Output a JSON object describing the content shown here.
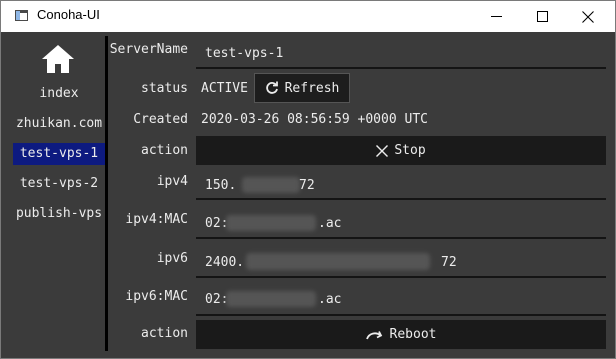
{
  "window": {
    "title": "Conoha-UI"
  },
  "sidebar": {
    "home_icon": "home-icon",
    "items": [
      {
        "label": "index",
        "active": false
      },
      {
        "label": "zhuikan.com",
        "active": false
      },
      {
        "label": "test-vps-1",
        "active": true
      },
      {
        "label": "test-vps-2",
        "active": false
      },
      {
        "label": "publish-vps",
        "active": false
      }
    ]
  },
  "details": {
    "server_name_label": "ServerName",
    "server_name_value": "test-vps-1",
    "status_label": "status",
    "status_value": "ACTIVE",
    "refresh_label": "Refresh",
    "created_label": "Created",
    "created_value": "2020-03-26 08:56:59 +0000 UTC",
    "action_label": "action",
    "stop_label": "Stop",
    "ipv4_label": "ipv4",
    "ipv4_value_start": "150.",
    "ipv4_value_end": "72",
    "ipv4_mac_label": "ipv4:MAC",
    "ipv4_mac_start": "02:",
    "ipv4_mac_end": ".ac",
    "ipv6_label": "ipv6",
    "ipv6_value_start": "2400.",
    "ipv6_value_end": "72",
    "ipv6_mac_label": "ipv6:MAC",
    "ipv6_mac_start": "02:",
    "ipv6_mac_end": ".ac",
    "action2_label": "action",
    "reboot_label": "Reboot"
  },
  "colors": {
    "accent": "#0d1a80",
    "background": "#3b3b3b",
    "button": "#1a1a1a"
  }
}
